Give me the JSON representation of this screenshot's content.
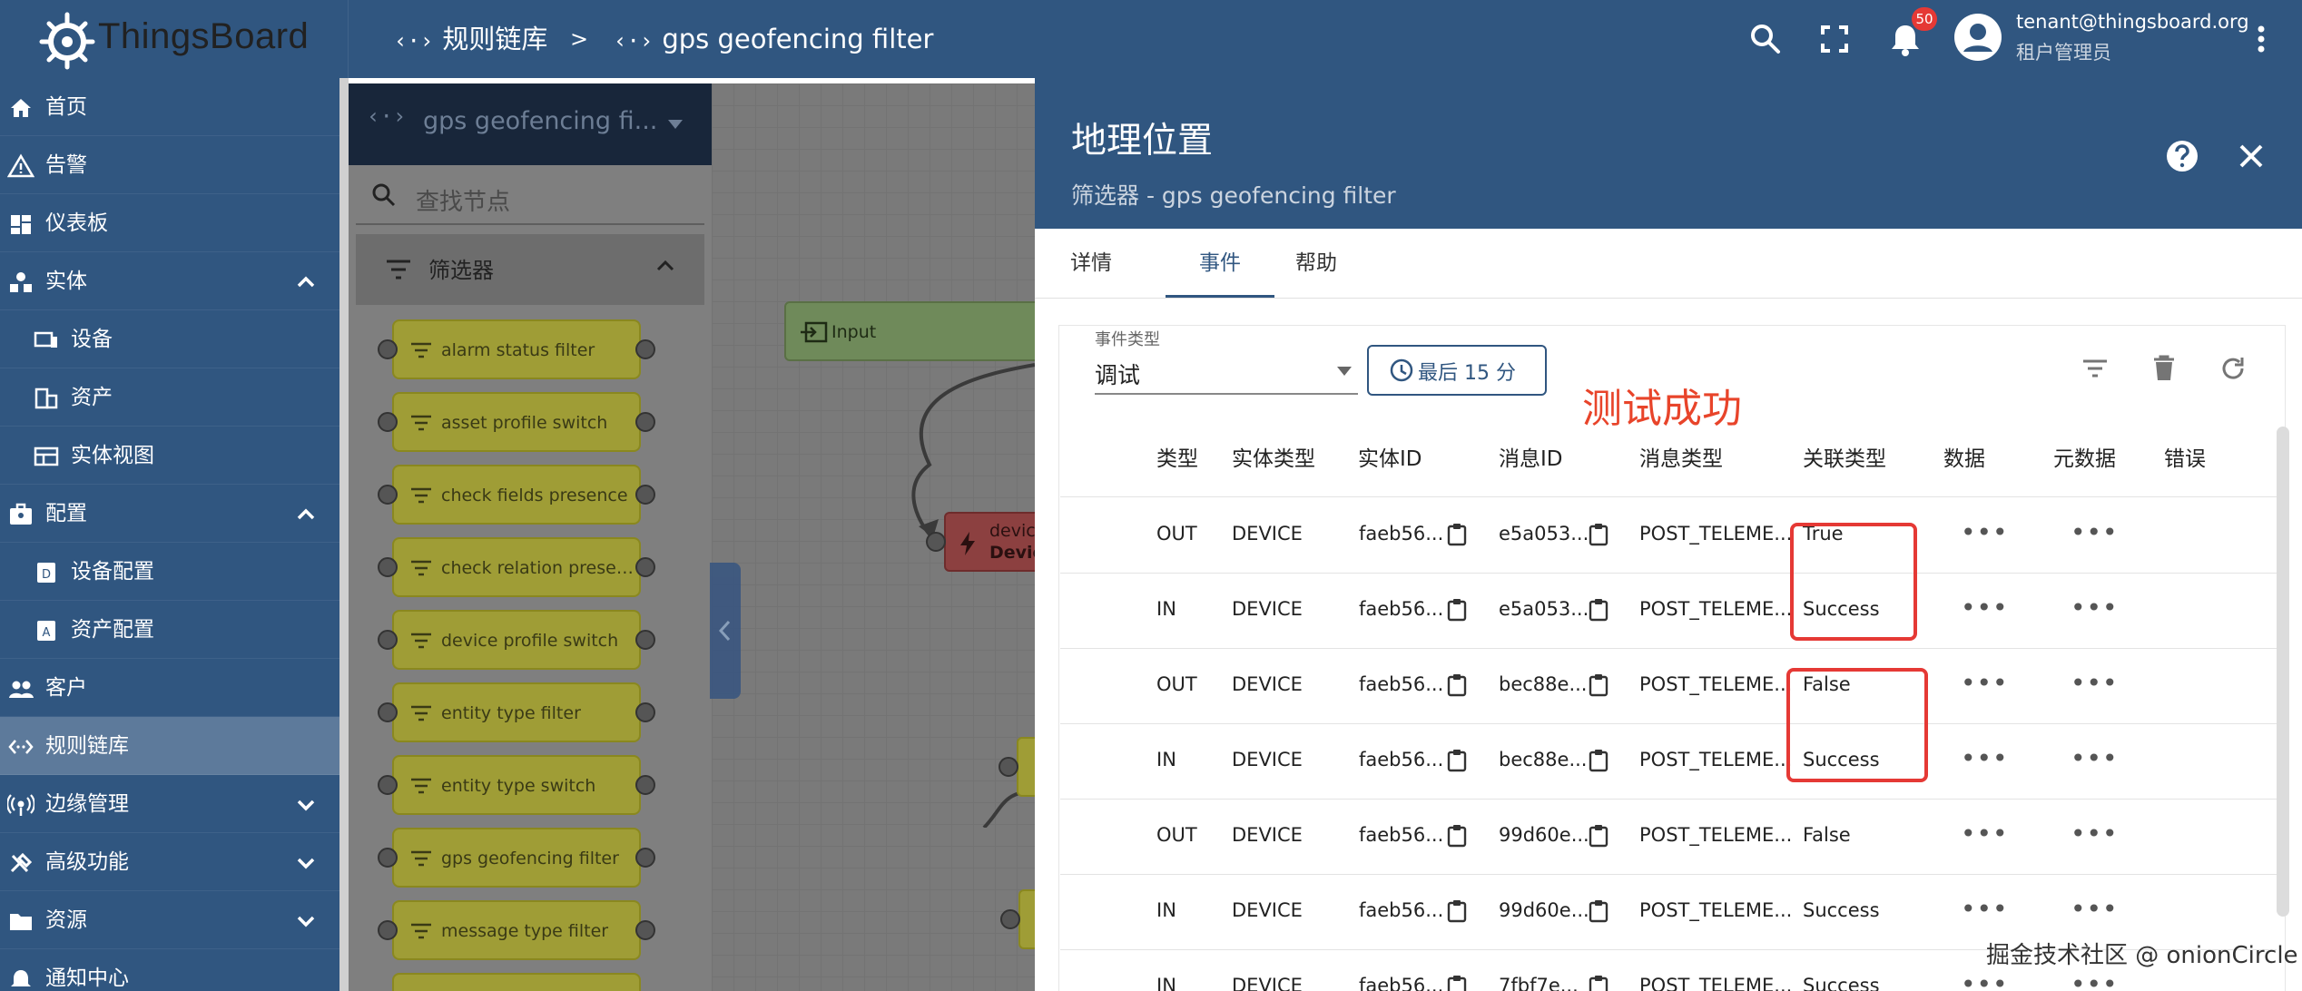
{
  "app": {
    "name": "ThingsBoard"
  },
  "breadcrumb": {
    "root": "规则链库",
    "separator": ">",
    "current": "gps geofencing filter",
    "icon_text": "‹·›"
  },
  "header": {
    "notification_count": "50",
    "user_email": "tenant@thingsboard.org",
    "user_role": "租户管理员"
  },
  "sidebar": {
    "items": [
      {
        "label": "首页",
        "icon": "home-icon"
      },
      {
        "label": "告警",
        "icon": "warning-icon"
      },
      {
        "label": "仪表板",
        "icon": "dashboard-icon"
      },
      {
        "label": "实体",
        "icon": "entity-icon",
        "expanded": true
      },
      {
        "label": "设备",
        "icon": "devices-icon"
      },
      {
        "label": "资产",
        "icon": "asset-icon"
      },
      {
        "label": "实体视图",
        "icon": "entity-view-icon"
      },
      {
        "label": "配置",
        "icon": "profile-icon",
        "expanded": true
      },
      {
        "label": "设备配置",
        "icon": "device-profile-icon"
      },
      {
        "label": "资产配置",
        "icon": "asset-profile-icon"
      },
      {
        "label": "客户",
        "icon": "customers-icon"
      },
      {
        "label": "规则链库",
        "icon": "rule-chain-icon",
        "active": true
      },
      {
        "label": "边缘管理",
        "icon": "edge-icon"
      },
      {
        "label": "高级功能",
        "icon": "tools-icon"
      },
      {
        "label": "资源",
        "icon": "folder-icon"
      },
      {
        "label": "通知中心",
        "icon": "notification-center-icon"
      }
    ]
  },
  "library": {
    "chain_name": "gps geofencing fi...",
    "search_placeholder": "查找节点",
    "section": "筛选器",
    "nodes": [
      "alarm status filter",
      "asset profile switch",
      "check fields presence",
      "check relation presen...",
      "device profile switch",
      "entity type filter",
      "entity type switch",
      "gps geofencing filter",
      "message type filter"
    ]
  },
  "canvas": {
    "input_node": "Input",
    "device_node_1": "device",
    "device_node_2": "Device"
  },
  "dialog": {
    "title": "地理位置",
    "subtitle": "筛选器 - gps geofencing filter",
    "tabs": [
      "详情",
      "事件",
      "帮助"
    ],
    "event_type_label": "事件类型",
    "event_type_value": "调试",
    "time_button": "最后 15 分",
    "annotation": "测试成功",
    "columns": [
      "类型",
      "实体类型",
      "实体ID",
      "消息ID",
      "消息类型",
      "关联类型",
      "数据",
      "元数据",
      "错误"
    ],
    "rows": [
      {
        "type": "OUT",
        "entity_type": "DEVICE",
        "entity_id": "faeb56...",
        "msg_id": "e5a053...",
        "msg_type": "POST_TELEME...",
        "relation": "True"
      },
      {
        "type": "IN",
        "entity_type": "DEVICE",
        "entity_id": "faeb56...",
        "msg_id": "e5a053...",
        "msg_type": "POST_TELEME...",
        "relation": "Success"
      },
      {
        "type": "OUT",
        "entity_type": "DEVICE",
        "entity_id": "faeb56...",
        "msg_id": "bec88e...",
        "msg_type": "POST_TELEME...",
        "relation": "False"
      },
      {
        "type": "IN",
        "entity_type": "DEVICE",
        "entity_id": "faeb56...",
        "msg_id": "bec88e...",
        "msg_type": "POST_TELEME...",
        "relation": "Success"
      },
      {
        "type": "OUT",
        "entity_type": "DEVICE",
        "entity_id": "faeb56...",
        "msg_id": "99d60e...",
        "msg_type": "POST_TELEME...",
        "relation": "False"
      },
      {
        "type": "IN",
        "entity_type": "DEVICE",
        "entity_id": "faeb56...",
        "msg_id": "99d60e...",
        "msg_type": "POST_TELEME...",
        "relation": "Success"
      },
      {
        "type": "IN",
        "entity_type": "DEVICE",
        "entity_id": "faeb56...",
        "msg_id": "7fbf7e...",
        "msg_type": "POST_TELEME...",
        "relation": "Success"
      }
    ],
    "more_glyph": "•••"
  },
  "watermark": "掘金技术社区 @ onionCircle",
  "colors": {
    "primary": "#305680",
    "annotation": "#e8442a",
    "node": "#9f9d36"
  }
}
